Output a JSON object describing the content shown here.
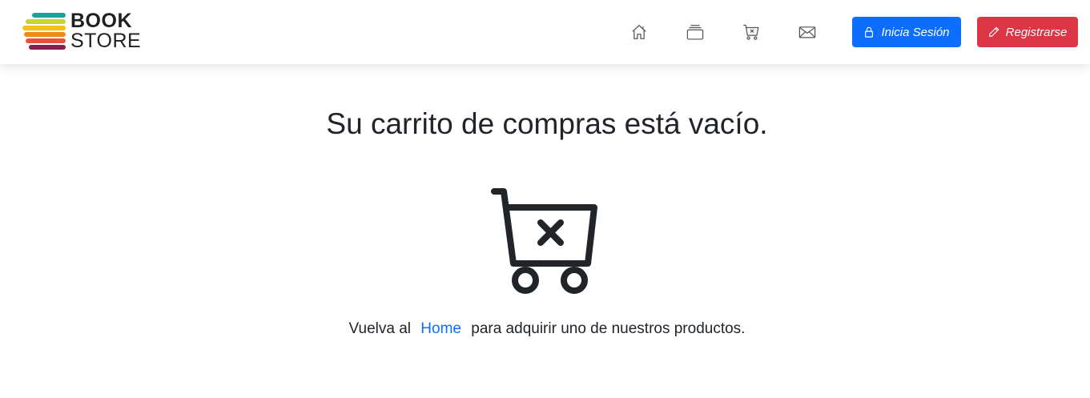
{
  "brand": {
    "line1": "BOOK",
    "line2": "STORE"
  },
  "nav": {
    "icons": [
      "house-icon",
      "collection-icon",
      "cart-x-icon",
      "envelope-icon"
    ]
  },
  "buttons": {
    "login_label": "Inicia Sesión",
    "register_label": "Registrarse"
  },
  "colors": {
    "primary": "#0d6efd",
    "danger": "#dc3545",
    "text": "#212529",
    "logo_bars": [
      "#1aa39a",
      "#c7d530",
      "#f2c11a",
      "#ef8a1f",
      "#e4543a",
      "#8c1d52"
    ]
  },
  "main": {
    "heading": "Su carrito de compras está vacío.",
    "message_before": "Vuelva al",
    "home_link": "Home",
    "message_after": "para adquirir uno de nuestros productos."
  }
}
